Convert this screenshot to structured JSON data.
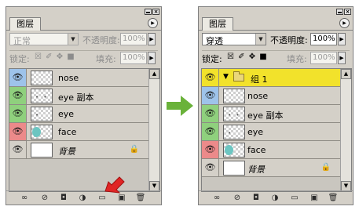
{
  "colors": {
    "panel_bg": "#d4d0c8",
    "group_highlight": "#f2e22b",
    "eye_blue": "#9ec3ea",
    "eye_green": "#8fd07d",
    "eye_red": "#ec8a8a",
    "green_arrow": "#6ab23a",
    "red_arrow": "#e02525"
  },
  "left_panel": {
    "tab_title": "图层",
    "blend_mode": "正常",
    "opacity_label": "不透明度:",
    "opacity_value": "100%",
    "lock_label": "锁定:",
    "fill_label": "填充:",
    "fill_value": "100%",
    "layers": [
      {
        "name": "nose",
        "eye_color": "eye_blue",
        "thumb": "transparent"
      },
      {
        "name": "eye 副本",
        "eye_color": "eye_green",
        "thumb": "transparent"
      },
      {
        "name": "eye",
        "eye_color": "eye_green",
        "thumb": "transparent"
      },
      {
        "name": "face",
        "eye_color": "eye_red",
        "thumb": "face"
      },
      {
        "name": "背景",
        "eye_color": "none",
        "thumb": "white",
        "locked": true
      }
    ]
  },
  "right_panel": {
    "tab_title": "图层",
    "blend_mode": "穿透",
    "opacity_label": "不透明度:",
    "opacity_value": "100%",
    "lock_label": "锁定:",
    "fill_label": "填充:",
    "fill_value": "100%",
    "group_name": "组 1",
    "layers": [
      {
        "name": "nose",
        "eye_color": "eye_blue",
        "thumb": "transparent"
      },
      {
        "name": "eye 副本",
        "eye_color": "eye_green",
        "thumb": "transparent"
      },
      {
        "name": "eye",
        "eye_color": "eye_green",
        "thumb": "transparent"
      },
      {
        "name": "face",
        "eye_color": "eye_red",
        "thumb": "face"
      },
      {
        "name": "背景",
        "eye_color": "none",
        "thumb": "white",
        "locked": true
      }
    ]
  },
  "icons": {
    "eye": "eye-icon",
    "lock": "lock-icon",
    "link": "link-layers-icon",
    "fx": "layer-style-icon",
    "mask": "add-mask-icon",
    "adjust": "adjustment-layer-icon",
    "folder": "new-group-icon",
    "new_layer": "new-layer-icon",
    "trash": "delete-layer-icon"
  }
}
